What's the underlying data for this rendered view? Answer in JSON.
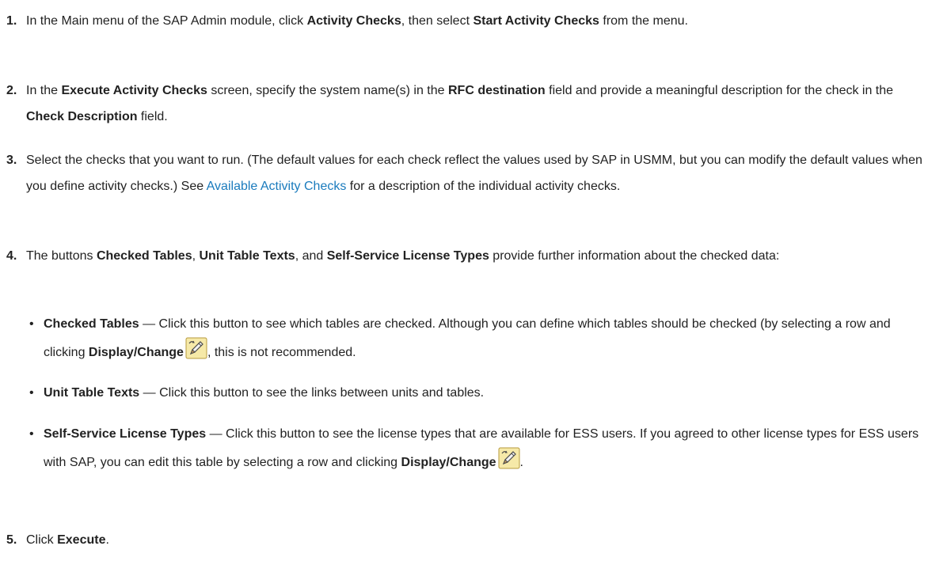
{
  "steps": [
    {
      "num": "1.",
      "t1": "In the Main menu of the SAP Admin module, click ",
      "b1": "Activity Checks",
      "t2": ", then select ",
      "b2": "Start Activity Checks",
      "t3": " from the menu."
    },
    {
      "num": "2.",
      "t1": "In the ",
      "b1": "Execute Activity Checks",
      "t2": " screen, specify the system name(s) in the ",
      "b2": "RFC destination",
      "t3": " field and provide a meaningful description for the check in the ",
      "b3": "Check Description",
      "t4": " field."
    },
    {
      "num": "3.",
      "t1": "Select the checks that you want to run. (The default values for each check reflect the values used by SAP in USMM, but you can modify the default values when you define activity checks.) See ",
      "link": "Available Activity Checks",
      "t2": " for a description of the individual activity checks."
    },
    {
      "num": "4.",
      "t1": "The buttons ",
      "b1": "Checked Tables",
      "t2": ", ",
      "b2": "Unit Table Texts",
      "t3": ", and ",
      "b3": "Self-Service License Types",
      "t4": " provide further information about the checked data:"
    },
    {
      "num": "5.",
      "t1": "Click ",
      "b1": "Execute",
      "t2": "."
    }
  ],
  "bullets": [
    {
      "dot": "•",
      "b1": "Checked Tables",
      "t1": " — Click this button to see which tables are checked. Although you can define which tables should be checked (by selecting a row and clicking ",
      "b2": "Display/Change",
      "t2": ", this is not recommended.",
      "icon": "pencil-edit-icon"
    },
    {
      "dot": "•",
      "b1": "Unit Table Texts",
      "t1": " — Click this button to see the links between units and tables."
    },
    {
      "dot": "•",
      "b1": "Self-Service License Types",
      "t1": " — Click this button to see the license types that are available for ESS users. If you agreed to other license types for ESS users with SAP, you can edit this table by selecting a row and clicking ",
      "b2": "Display/Change",
      "t2": ".",
      "icon": "pencil-edit-icon"
    }
  ],
  "colors": {
    "text": "#222222",
    "link": "#1a7bbd",
    "icon_bg": "#f6e9a8",
    "icon_border": "#b79a3c"
  }
}
